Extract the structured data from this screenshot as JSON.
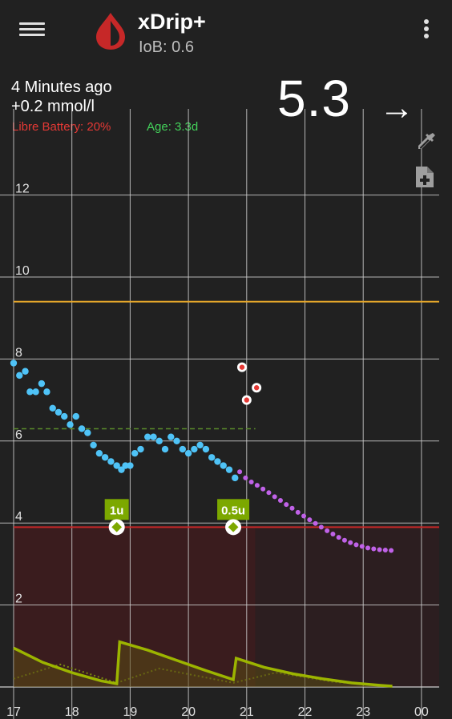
{
  "app": {
    "title": "xDrip+",
    "subtitle": "IoB: 0.6",
    "icons": {
      "menu": "menu-icon",
      "logo": "blood-drop-icon",
      "overflow": "more-vert-icon"
    }
  },
  "status": {
    "minutes_ago": "4 Minutes ago",
    "delta": "+0.2 mmol/l",
    "battery": "Libre Battery: 20%",
    "sensor_age": "Age: 3.3d",
    "bg": "5.3",
    "trend": "→"
  },
  "tools": {
    "calibrate_icon": "eyedropper-icon",
    "note_icon": "note-add-icon"
  },
  "colors": {
    "background": "#212121",
    "battery_text": "#e53935",
    "age_text": "#43d15a",
    "bg_reading": "#4fc3f7",
    "prediction": "#c062e8",
    "high_line": "#e6a72a",
    "low_line": "#c62828",
    "low_area": "#3a1c1e",
    "treatment": "#7ca800",
    "iob": "#9cb400",
    "target": "#5a8a2a"
  },
  "chart_data": {
    "type": "scatter",
    "ylabel": "mmol/l",
    "ylim": [
      0,
      14
    ],
    "xlim": [
      17.0,
      24.3
    ],
    "y_ticks": [
      2,
      4,
      6,
      8,
      10,
      12
    ],
    "x_ticks": [
      {
        "v": 17,
        "label": "17"
      },
      {
        "v": 18,
        "label": "18"
      },
      {
        "v": 19,
        "label": "19"
      },
      {
        "v": 20,
        "label": "20"
      },
      {
        "v": 21,
        "label": "21"
      },
      {
        "v": 22,
        "label": "22"
      },
      {
        "v": 23,
        "label": "23"
      },
      {
        "v": 24,
        "label": "00"
      }
    ],
    "high_line": 9.4,
    "low_line": 3.9,
    "target_line": 6.3,
    "series": [
      {
        "name": "Glucose",
        "points": [
          [
            17.0,
            7.9
          ],
          [
            17.1,
            7.6
          ],
          [
            17.2,
            7.7
          ],
          [
            17.28,
            7.2
          ],
          [
            17.38,
            7.2
          ],
          [
            17.48,
            7.4
          ],
          [
            17.57,
            7.2
          ],
          [
            17.67,
            6.8
          ],
          [
            17.77,
            6.7
          ],
          [
            17.87,
            6.6
          ],
          [
            17.97,
            6.4
          ],
          [
            18.07,
            6.6
          ],
          [
            18.17,
            6.3
          ],
          [
            18.27,
            6.2
          ],
          [
            18.37,
            5.9
          ],
          [
            18.47,
            5.7
          ],
          [
            18.57,
            5.6
          ],
          [
            18.67,
            5.5
          ],
          [
            18.77,
            5.4
          ],
          [
            18.85,
            5.3
          ],
          [
            18.92,
            5.4
          ],
          [
            19.0,
            5.4
          ],
          [
            19.08,
            5.7
          ],
          [
            19.18,
            5.8
          ],
          [
            19.3,
            6.1
          ],
          [
            19.4,
            6.1
          ],
          [
            19.5,
            6.0
          ],
          [
            19.6,
            5.8
          ],
          [
            19.7,
            6.1
          ],
          [
            19.8,
            6.0
          ],
          [
            19.9,
            5.8
          ],
          [
            20.0,
            5.7
          ],
          [
            20.1,
            5.8
          ],
          [
            20.2,
            5.9
          ],
          [
            20.3,
            5.8
          ],
          [
            20.4,
            5.6
          ],
          [
            20.5,
            5.5
          ],
          [
            20.6,
            5.4
          ],
          [
            20.7,
            5.3
          ],
          [
            20.8,
            5.1
          ]
        ]
      },
      {
        "name": "Prediction",
        "points": [
          [
            20.88,
            5.25
          ],
          [
            20.98,
            5.1
          ],
          [
            21.08,
            5.0
          ],
          [
            21.18,
            4.92
          ],
          [
            21.28,
            4.83
          ],
          [
            21.38,
            4.74
          ],
          [
            21.48,
            4.64
          ],
          [
            21.58,
            4.55
          ],
          [
            21.68,
            4.45
          ],
          [
            21.78,
            4.36
          ],
          [
            21.88,
            4.26
          ],
          [
            21.98,
            4.17
          ],
          [
            22.08,
            4.08
          ],
          [
            22.18,
            3.99
          ],
          [
            22.28,
            3.9
          ],
          [
            22.38,
            3.81
          ],
          [
            22.48,
            3.73
          ],
          [
            22.58,
            3.65
          ],
          [
            22.68,
            3.58
          ],
          [
            22.78,
            3.52
          ],
          [
            22.88,
            3.47
          ],
          [
            22.98,
            3.43
          ],
          [
            23.08,
            3.39
          ],
          [
            23.18,
            3.37
          ],
          [
            23.28,
            3.35
          ],
          [
            23.38,
            3.34
          ],
          [
            23.48,
            3.33
          ]
        ]
      },
      {
        "name": "Fingerstick",
        "points": [
          [
            20.92,
            7.8
          ],
          [
            21.0,
            7.0
          ],
          [
            21.17,
            7.3
          ]
        ]
      }
    ],
    "treatments": [
      {
        "x": 18.77,
        "y": 3.9,
        "label": "1u"
      },
      {
        "x": 20.77,
        "y": 3.9,
        "label": "0.5u"
      }
    ],
    "iob_curve": [
      [
        17.0,
        0.95
      ],
      [
        17.5,
        0.6
      ],
      [
        18.0,
        0.35
      ],
      [
        18.5,
        0.15
      ],
      [
        18.77,
        0.08
      ],
      [
        18.82,
        1.1
      ],
      [
        19.3,
        0.9
      ],
      [
        19.8,
        0.65
      ],
      [
        20.3,
        0.4
      ],
      [
        20.77,
        0.18
      ],
      [
        20.82,
        0.7
      ],
      [
        21.3,
        0.48
      ],
      [
        21.8,
        0.32
      ],
      [
        22.3,
        0.2
      ],
      [
        22.8,
        0.1
      ],
      [
        23.3,
        0.04
      ],
      [
        23.5,
        0.02
      ]
    ],
    "cob_curve": [
      [
        17.0,
        0.2
      ],
      [
        17.8,
        0.55
      ],
      [
        18.77,
        0.1
      ],
      [
        19.5,
        0.45
      ],
      [
        20.77,
        0.1
      ],
      [
        21.5,
        0.35
      ],
      [
        22.5,
        0.12
      ],
      [
        23.5,
        0.02
      ]
    ]
  }
}
